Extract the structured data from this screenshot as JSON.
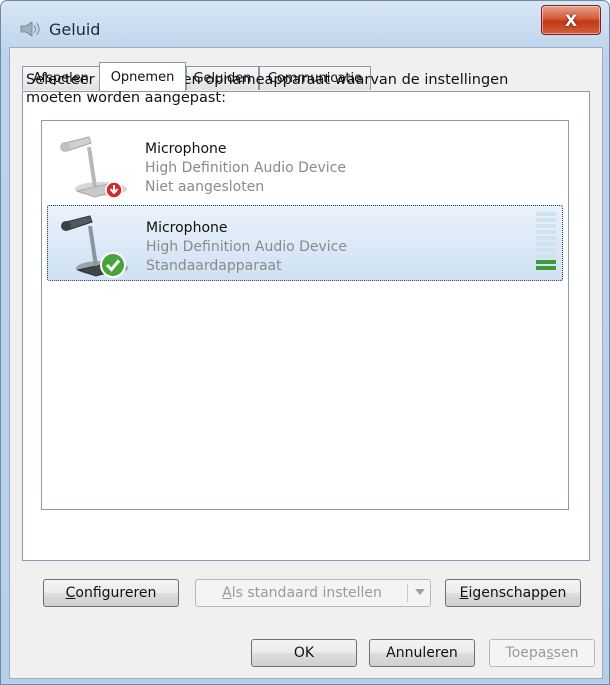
{
  "window": {
    "title": "Geluid",
    "close_label": "X"
  },
  "tabs": [
    {
      "label": "Afspelen",
      "active": false
    },
    {
      "label": "Opnemen",
      "active": true
    },
    {
      "label": "Geluiden",
      "active": false
    },
    {
      "label": "Communicatie",
      "active": false
    }
  ],
  "instruction": "Selecteer hieronder een opnameapparaat waarvan de instellingen moeten worden aangepast:",
  "devices": [
    {
      "name": "Microphone",
      "driver": "High Definition Audio Device",
      "status": "Niet aangesloten",
      "status_icon": "disconnected-icon",
      "selected": false
    },
    {
      "name": "Microphone",
      "driver": "High Definition Audio Device",
      "status": "Standaardapparaat",
      "status_icon": "default-check-icon",
      "selected": true,
      "level_fraction": 0.2
    }
  ],
  "panel_buttons": {
    "configure": {
      "mnemonic": "C",
      "rest": "onfigureren"
    },
    "set_default": {
      "mnemonic": "A",
      "rest": "ls standaard instellen",
      "disabled": true
    },
    "properties": {
      "mnemonic": "E",
      "rest": "igenschappen"
    }
  },
  "dialog_buttons": {
    "ok": "OK",
    "cancel": "Annuleren",
    "apply": {
      "before": "Toepa",
      "mnemonic": "s",
      "after": "sen",
      "disabled": true
    }
  },
  "colors": {
    "selection": "#cfe1f3",
    "meter_active": "#3f9b3a",
    "meter_idle": "#cfe3ee",
    "close_button": "#c8482a"
  }
}
